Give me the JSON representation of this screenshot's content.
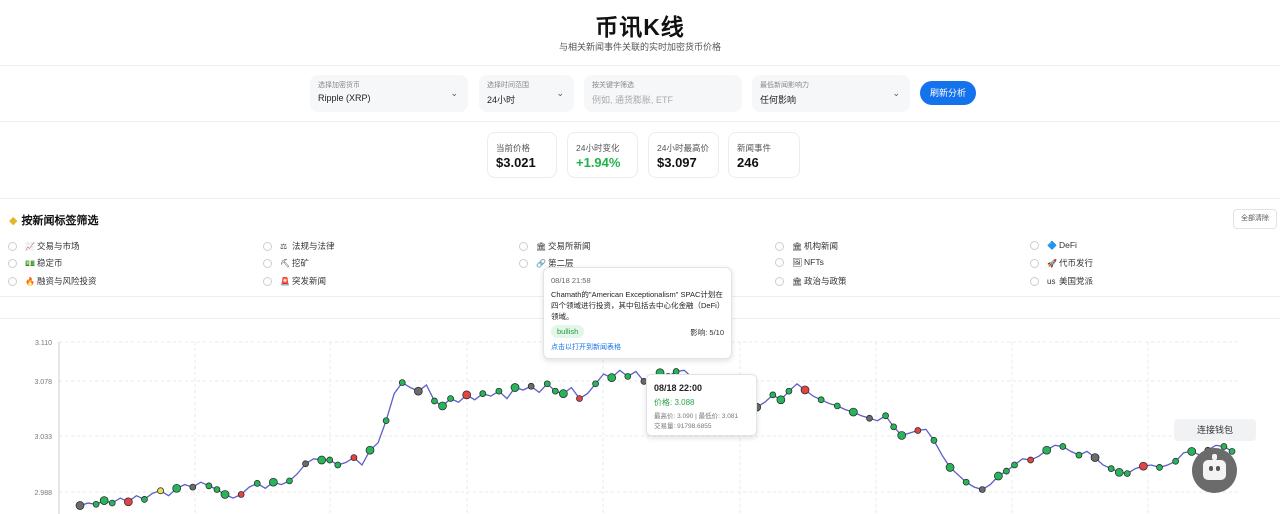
{
  "header": {
    "title": "币讯K线",
    "subtitle": "与相关新闻事件关联的实时加密货币价格"
  },
  "filters": {
    "crypto": {
      "label": "选择加密货币",
      "value": "Ripple (XRP)"
    },
    "timerange": {
      "label": "选择时间范围",
      "value": "24小时"
    },
    "keyword": {
      "label": "按关键字筛选",
      "placeholder": "例如, 通货膨胀, ETF"
    },
    "impact": {
      "label": "最低新闻影响力",
      "value": "任何影响"
    },
    "refresh_label": "刷新分析"
  },
  "stats": [
    {
      "label": "当前价格",
      "value": "$3.021"
    },
    {
      "label": "24小时变化",
      "value": "+1.94%"
    },
    {
      "label": "24小时最高价",
      "value": "$3.097"
    },
    {
      "label": "新闻事件",
      "value": "246"
    }
  ],
  "tags": {
    "title": "按新闻标签筛选",
    "clear_label": "全部清除",
    "items": [
      {
        "label": "交易与市场",
        "icon": "chart-icon",
        "glyph": "📈"
      },
      {
        "label": "法规与法律",
        "icon": "scale-icon",
        "glyph": "⚖"
      },
      {
        "label": "交易所新闻",
        "icon": "bank-icon",
        "glyph": "🏛"
      },
      {
        "label": "机构新闻",
        "icon": "building-icon",
        "glyph": "🏛"
      },
      {
        "label": "DeFi",
        "icon": "defi-icon",
        "glyph": "🔷"
      },
      {
        "label": "稳定币",
        "icon": "money-icon",
        "glyph": "💵"
      },
      {
        "label": "挖矿",
        "icon": "pickaxe-icon",
        "glyph": "⛏"
      },
      {
        "label": "第二层",
        "icon": "link-icon",
        "glyph": "🔗"
      },
      {
        "label": "NFTs",
        "icon": "image-icon",
        "glyph": "🖼"
      },
      {
        "label": "代币发行",
        "icon": "rocket-icon",
        "glyph": "🚀"
      },
      {
        "label": "融资与风险投资",
        "icon": "fire-icon",
        "glyph": "🔥"
      },
      {
        "label": "突发新闻",
        "icon": "alert-icon",
        "glyph": "🚨"
      },
      {
        "label": "",
        "icon": "",
        "glyph": ""
      },
      {
        "label": "政治与政策",
        "icon": "capitol-icon",
        "glyph": "🏛"
      },
      {
        "label": "美国党派",
        "icon": "us-flag-icon",
        "glyph": "us"
      }
    ]
  },
  "chart_data": {
    "type": "line",
    "ytick_labels": [
      "3.110",
      "3.078",
      "3.033",
      "2.988"
    ],
    "ylim": [
      2.97,
      3.11
    ],
    "color_line": "#5b5fc7",
    "color_bullish": "#27b45a",
    "color_bearish": "#e04545",
    "color_neutral": "#6b6b6b",
    "series": [
      {
        "values": [
          2.977,
          2.979,
          2.978,
          2.981,
          2.979,
          2.983,
          2.98,
          2.985,
          2.982,
          2.987,
          2.989,
          2.985,
          2.991,
          2.994,
          2.992,
          2.996,
          2.993,
          2.99,
          2.986,
          2.983,
          2.986,
          2.992,
          2.995,
          2.991,
          2.996,
          2.994,
          2.997,
          3.003,
          3.011,
          3.015,
          3.014,
          3.014,
          3.01,
          3.012,
          3.016,
          3.01,
          3.022,
          3.028,
          3.046,
          3.068,
          3.077,
          3.073,
          3.07,
          3.075,
          3.062,
          3.058,
          3.064,
          3.061,
          3.067,
          3.063,
          3.068,
          3.066,
          3.07,
          3.064,
          3.073,
          3.071,
          3.074,
          3.069,
          3.076,
          3.07,
          3.068,
          3.073,
          3.064,
          3.068,
          3.076,
          3.084,
          3.081,
          3.087,
          3.082,
          3.086,
          3.078,
          3.079,
          3.085,
          3.082,
          3.086,
          3.087,
          3.081,
          3.078,
          3.071,
          3.07,
          3.072,
          3.064,
          3.06,
          3.05,
          3.057,
          3.061,
          3.067,
          3.063,
          3.07,
          3.076,
          3.071,
          3.066,
          3.063,
          3.06,
          3.058,
          3.055,
          3.053,
          3.05,
          3.048,
          3.046,
          3.05,
          3.041,
          3.034,
          3.036,
          3.038,
          3.039,
          3.03,
          3.018,
          3.008,
          3.002,
          2.996,
          2.992,
          2.99,
          2.994,
          3.001,
          3.005,
          3.01,
          3.015,
          3.014,
          3.017,
          3.022,
          3.026,
          3.025,
          3.021,
          3.018,
          3.021,
          3.016,
          3.01,
          3.007,
          3.004,
          3.003,
          3.007,
          3.009,
          3.01,
          3.008,
          3.01,
          3.013,
          3.02,
          3.021,
          3.018,
          3.022,
          3.026,
          3.025,
          3.021
        ]
      }
    ]
  },
  "tooltip_news": {
    "time": "08/18 21:58",
    "text": "Chamath的\"American Exceptionalism\" SPAC计划在四个领域进行投资，其中包括去中心化金融（DeFi）领域。",
    "sentiment": "bullish",
    "impact": "影响: 5/10",
    "link": "点击以打开到新闻表格"
  },
  "tooltip_price": {
    "time": "08/18 22:00",
    "price": "价格: 3.088",
    "hl": "最高价: 3.090 | 最低价: 3.081",
    "volume": "交易量: 91798.6855"
  },
  "wallet_label": "连接钱包"
}
